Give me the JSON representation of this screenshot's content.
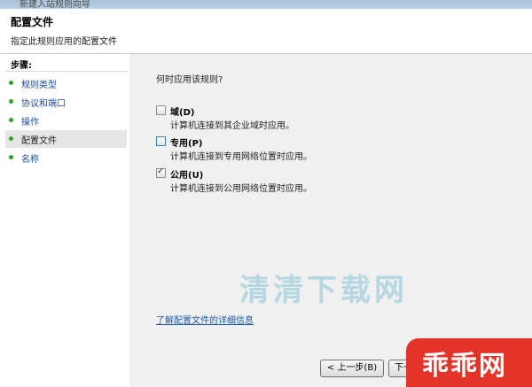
{
  "window": {
    "title": "新建入站规则向导"
  },
  "header": {
    "title": "配置文件",
    "subtitle": "指定此规则应用的配置文件"
  },
  "sidebar": {
    "heading": "步骤:",
    "items": [
      {
        "label": "规则类型",
        "current": false
      },
      {
        "label": "协议和端口",
        "current": false
      },
      {
        "label": "操作",
        "current": false
      },
      {
        "label": "配置文件",
        "current": true
      },
      {
        "label": "名称",
        "current": false
      }
    ]
  },
  "main": {
    "question": "何时应用该规则?",
    "options": [
      {
        "label": "域(D)",
        "description": "计算机连接到其企业域时应用。",
        "checked": false
      },
      {
        "label": "专用(P)",
        "description": "计算机连接到专用网络位置时应用。",
        "checked": false
      },
      {
        "label": "公用(U)",
        "description": "计算机连接到公用网络位置时应用。",
        "checked": true
      }
    ],
    "learn_more_link": "了解配置文件的详细信息"
  },
  "buttons": {
    "back_label": "< 上一步(B)",
    "next_label": "下一步(N) >"
  },
  "watermark": {
    "text": "清清下载网",
    "logo": "乖乖网"
  },
  "icons": {
    "checkbox_check": "✓"
  },
  "colors": {
    "step_dot": "#2fa32b",
    "link": "#1f5aa6",
    "watermark_badge": "#e4342a"
  }
}
